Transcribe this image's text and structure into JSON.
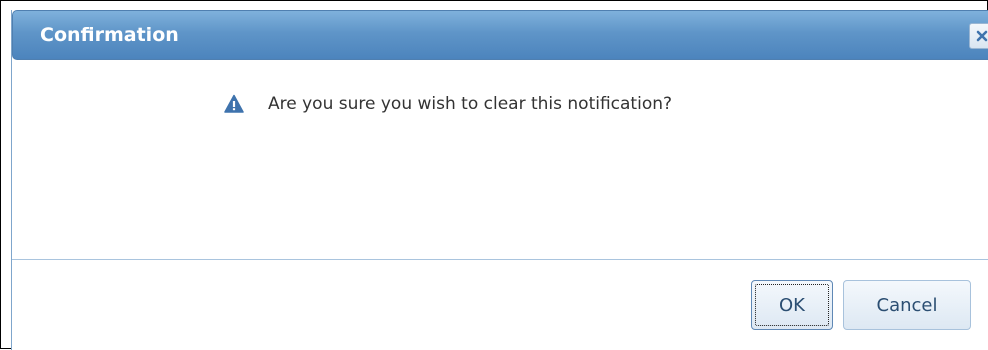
{
  "dialog": {
    "title": "Confirmation",
    "close_icon": "close-icon",
    "message_icon": "warning-icon",
    "message": "Are you sure you wish to clear this notification?",
    "buttons": {
      "ok_label": "OK",
      "cancel_label": "Cancel"
    }
  },
  "colors": {
    "titlebar": "#5f95c8",
    "title_text": "#ffffff",
    "icon": "#3f73ad",
    "button_text": "#2b4e72"
  }
}
